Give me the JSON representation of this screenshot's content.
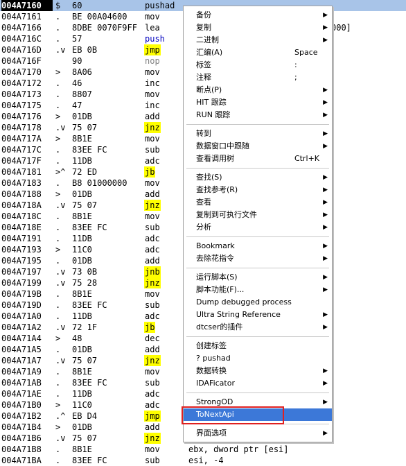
{
  "disasm_rows": [
    {
      "addr": "004A7160",
      "mark": "$",
      "hex": "60",
      "mn": "pushad",
      "ops": "",
      "cls": ""
    },
    {
      "addr": "004A7161",
      "mark": ".",
      "hex": "BE 00A04600",
      "mn": "mov",
      "ops": "",
      "cls": ""
    },
    {
      "addr": "004A7166",
      "mark": ".",
      "hex": "8DBE 0070F9FF",
      "mn": "lea",
      "ops": "",
      "cls": ""
    },
    {
      "addr": "004A716C",
      "mark": ".",
      "hex": "57",
      "mn": "push",
      "ops": "",
      "cls": "push"
    },
    {
      "addr": "004A716D",
      "mark": ".v",
      "hex": "EB 0B",
      "mn": "jmp",
      "ops": "",
      "cls": "jmp"
    },
    {
      "addr": "004A716F",
      "mark": "",
      "hex": "90",
      "mn": "nop",
      "ops": "",
      "cls": "gray"
    },
    {
      "addr": "004A7170",
      "mark": ">",
      "hex": "8A06",
      "mn": "mov",
      "ops": "",
      "cls": ""
    },
    {
      "addr": "004A7172",
      "mark": ".",
      "hex": "46",
      "mn": "inc",
      "ops": "",
      "cls": ""
    },
    {
      "addr": "004A7173",
      "mark": ".",
      "hex": "8807",
      "mn": "mov",
      "ops": "",
      "cls": ""
    },
    {
      "addr": "004A7175",
      "mark": ".",
      "hex": "47",
      "mn": "inc",
      "ops": "",
      "cls": ""
    },
    {
      "addr": "004A7176",
      "mark": ">",
      "hex": "01DB",
      "mn": "add",
      "ops": "",
      "cls": ""
    },
    {
      "addr": "004A7178",
      "mark": ".v",
      "hex": "75 07",
      "mn": "jnz",
      "ops": "",
      "cls": "jmp"
    },
    {
      "addr": "004A717A",
      "mark": ">",
      "hex": "8B1E",
      "mn": "mov",
      "ops": "",
      "cls": ""
    },
    {
      "addr": "004A717C",
      "mark": ".",
      "hex": "83EE FC",
      "mn": "sub",
      "ops": "",
      "cls": ""
    },
    {
      "addr": "004A717F",
      "mark": ".",
      "hex": "11DB",
      "mn": "adc",
      "ops": "",
      "cls": ""
    },
    {
      "addr": "004A7181",
      "mark": ">^",
      "hex": "72 ED",
      "mn": "jb",
      "ops": "",
      "cls": "jmp"
    },
    {
      "addr": "004A7183",
      "mark": ".",
      "hex": "B8 01000000",
      "mn": "mov",
      "ops": "",
      "cls": ""
    },
    {
      "addr": "004A7188",
      "mark": ">",
      "hex": "01DB",
      "mn": "add",
      "ops": "",
      "cls": ""
    },
    {
      "addr": "004A718A",
      "mark": ".v",
      "hex": "75 07",
      "mn": "jnz",
      "ops": "",
      "cls": "jmp"
    },
    {
      "addr": "004A718C",
      "mark": ".",
      "hex": "8B1E",
      "mn": "mov",
      "ops": "",
      "cls": ""
    },
    {
      "addr": "004A718E",
      "mark": ".",
      "hex": "83EE FC",
      "mn": "sub",
      "ops": "",
      "cls": ""
    },
    {
      "addr": "004A7191",
      "mark": ".",
      "hex": "11DB",
      "mn": "adc",
      "ops": "",
      "cls": ""
    },
    {
      "addr": "004A7193",
      "mark": ">",
      "hex": "11C0",
      "mn": "adc",
      "ops": "",
      "cls": ""
    },
    {
      "addr": "004A7195",
      "mark": ".",
      "hex": "01DB",
      "mn": "add",
      "ops": "",
      "cls": ""
    },
    {
      "addr": "004A7197",
      "mark": ".v",
      "hex": "73 0B",
      "mn": "jnb",
      "ops": "",
      "cls": "jmp"
    },
    {
      "addr": "004A7199",
      "mark": ".v",
      "hex": "75 28",
      "mn": "jnz",
      "ops": "",
      "cls": "jmp"
    },
    {
      "addr": "004A719B",
      "mark": ".",
      "hex": "8B1E",
      "mn": "mov",
      "ops": "",
      "cls": ""
    },
    {
      "addr": "004A719D",
      "mark": ".",
      "hex": "83EE FC",
      "mn": "sub",
      "ops": "",
      "cls": ""
    },
    {
      "addr": "004A71A0",
      "mark": ".",
      "hex": "11DB",
      "mn": "adc",
      "ops": "",
      "cls": ""
    },
    {
      "addr": "004A71A2",
      "mark": ".v",
      "hex": "72 1F",
      "mn": "jb",
      "ops": "",
      "cls": "jmp"
    },
    {
      "addr": "004A71A4",
      "mark": ">",
      "hex": "48",
      "mn": "dec",
      "ops": "",
      "cls": ""
    },
    {
      "addr": "004A71A5",
      "mark": ".",
      "hex": "01DB",
      "mn": "add",
      "ops": "",
      "cls": ""
    },
    {
      "addr": "004A71A7",
      "mark": ".v",
      "hex": "75 07",
      "mn": "jnz",
      "ops": "",
      "cls": "jmp"
    },
    {
      "addr": "004A71A9",
      "mark": ".",
      "hex": "8B1E",
      "mn": "mov",
      "ops": "",
      "cls": ""
    },
    {
      "addr": "004A71AB",
      "mark": ".",
      "hex": "83EE FC",
      "mn": "sub",
      "ops": "",
      "cls": ""
    },
    {
      "addr": "004A71AE",
      "mark": ".",
      "hex": "11DB",
      "mn": "adc",
      "ops": "",
      "cls": ""
    },
    {
      "addr": "004A71B0",
      "mark": ">",
      "hex": "11C0",
      "mn": "adc",
      "ops": "",
      "cls": ""
    },
    {
      "addr": "004A71B2",
      "mark": ".^",
      "hex": "EB D4",
      "mn": "jmp",
      "ops": "",
      "cls": "jmp"
    },
    {
      "addr": "004A71B4",
      "mark": ">",
      "hex": "01DB",
      "mn": "add",
      "ops": "",
      "cls": ""
    },
    {
      "addr": "004A71B6",
      "mark": ".v",
      "hex": "75 07",
      "mn": "jnz",
      "ops": "",
      "cls": "jmp"
    },
    {
      "addr": "004A71B8",
      "mark": ".",
      "hex": "8B1E",
      "mn": "mov",
      "ops": "ebx, dword ptr [esi]",
      "cls": ""
    },
    {
      "addr": "004A71BA",
      "mark": ".",
      "hex": "83EE FC",
      "mn": "sub",
      "ops": "esi, -4",
      "cls": ""
    }
  ],
  "operand_fragment": "000]",
  "context_menu": [
    {
      "label": "备份",
      "shortcut": "",
      "arrow": true
    },
    {
      "label": "复制",
      "shortcut": "",
      "arrow": true
    },
    {
      "label": "二进制",
      "shortcut": "",
      "arrow": true
    },
    {
      "label": "汇编(A)",
      "shortcut": "Space",
      "arrow": false
    },
    {
      "label": "标签",
      "shortcut": ":",
      "arrow": false
    },
    {
      "label": "注释",
      "shortcut": ";",
      "arrow": false
    },
    {
      "label": "断点(P)",
      "shortcut": "",
      "arrow": true
    },
    {
      "label": "HIT 跟踪",
      "shortcut": "",
      "arrow": true
    },
    {
      "label": "RUN 跟踪",
      "shortcut": "",
      "arrow": true
    },
    {
      "sep": true
    },
    {
      "label": "转到",
      "shortcut": "",
      "arrow": true
    },
    {
      "label": "数据窗口中跟随",
      "shortcut": "",
      "arrow": true
    },
    {
      "label": "查看调用树",
      "shortcut": "Ctrl+K",
      "arrow": false
    },
    {
      "sep": true
    },
    {
      "label": "查找(S)",
      "shortcut": "",
      "arrow": true
    },
    {
      "label": "查找参考(R)",
      "shortcut": "",
      "arrow": true
    },
    {
      "label": "查看",
      "shortcut": "",
      "arrow": true
    },
    {
      "label": "复制到可执行文件",
      "shortcut": "",
      "arrow": true
    },
    {
      "label": "分析",
      "shortcut": "",
      "arrow": true
    },
    {
      "sep": true
    },
    {
      "label": "Bookmark",
      "shortcut": "",
      "arrow": true
    },
    {
      "label": "去除花指令",
      "shortcut": "",
      "arrow": true
    },
    {
      "sep": true
    },
    {
      "label": "运行脚本(S)",
      "shortcut": "",
      "arrow": true
    },
    {
      "label": "脚本功能(F)...",
      "shortcut": "",
      "arrow": true
    },
    {
      "label": "Dump debugged process",
      "shortcut": "",
      "arrow": false
    },
    {
      "label": "Ultra String Reference",
      "shortcut": "",
      "arrow": true
    },
    {
      "label": "dtcser的插件",
      "shortcut": "",
      "arrow": true
    },
    {
      "sep": true
    },
    {
      "label": "创建标签",
      "shortcut": "",
      "arrow": false
    },
    {
      "label": "? pushad",
      "shortcut": "",
      "arrow": false
    },
    {
      "label": "数据转换",
      "shortcut": "",
      "arrow": true
    },
    {
      "label": "IDAFicator",
      "shortcut": "",
      "arrow": true
    },
    {
      "sep": true
    },
    {
      "label": "StrongOD",
      "shortcut": "",
      "arrow": true
    },
    {
      "label": "ToNextApi",
      "shortcut": "",
      "arrow": false,
      "highlighted": true
    },
    {
      "sep": true
    },
    {
      "label": "界面选项",
      "shortcut": "",
      "arrow": true
    }
  ]
}
